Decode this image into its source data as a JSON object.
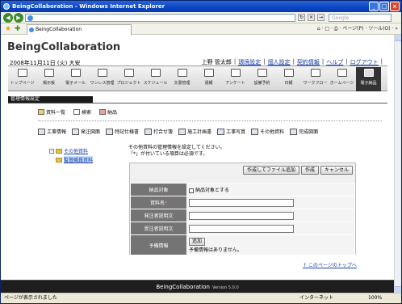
{
  "browser": {
    "window_title": "BeingCollaboration - Windows Internet Explorer",
    "search_placeholder": "Google",
    "tab_title": "BeingCollaboration",
    "tools": "⌂ · □ · ⎙ · ページ(P) · ツール(O) · »",
    "status_left": "ページが表示されました",
    "status_zone": "インターネット",
    "status_zoom": "100%"
  },
  "site": {
    "title": "BeingCollaboration",
    "date": "2008年11月11日 (火) 大安"
  },
  "user_links": [
    "上野 管太郎",
    "環境設定",
    "個人設定",
    "契約情報",
    "ヘルプ",
    "ログアウト"
  ],
  "toolbar": [
    "トップページ",
    "掲示板",
    "電子メール",
    "ワンレス管理",
    "プロジェクト",
    "スケジュール",
    "文書管理",
    "週報",
    "アンケート",
    "設備予約",
    "日報",
    "ワークフロー",
    "ホームページ",
    "電子納品"
  ],
  "section_title": "管理情報設定",
  "subnav": [
    "資料一覧",
    "検索",
    "納品"
  ],
  "docbar": [
    "工事情報",
    "発注図面",
    "特記仕様書",
    "打合せ簿",
    "施工計画書",
    "工事写真",
    "その他資料",
    "完成図面"
  ],
  "tree": {
    "root": "その他資料",
    "child": "監督職員資料"
  },
  "description": {
    "line1": "その他資料の管理情報を設定してください。",
    "line2": "「*」が付いている項目は必須です。"
  },
  "form": {
    "buttons": [
      "作成してファイル追加",
      "作成",
      "キャンセル"
    ],
    "rows": {
      "target_label": "納品対象",
      "target_check": "納品対象とする",
      "name_label": "資料名",
      "name_required": "*",
      "client_desc_label": "発注者説明文",
      "contractor_desc_label": "受注者説明文",
      "reserve_label": "予備情報",
      "reserve_add": "追加",
      "reserve_empty": "予備情報はありません。"
    }
  },
  "page_top_link": "↑ このページのトップへ",
  "footer": {
    "brand": "BeingCollaboration",
    "version": "Version 5.0.0"
  }
}
